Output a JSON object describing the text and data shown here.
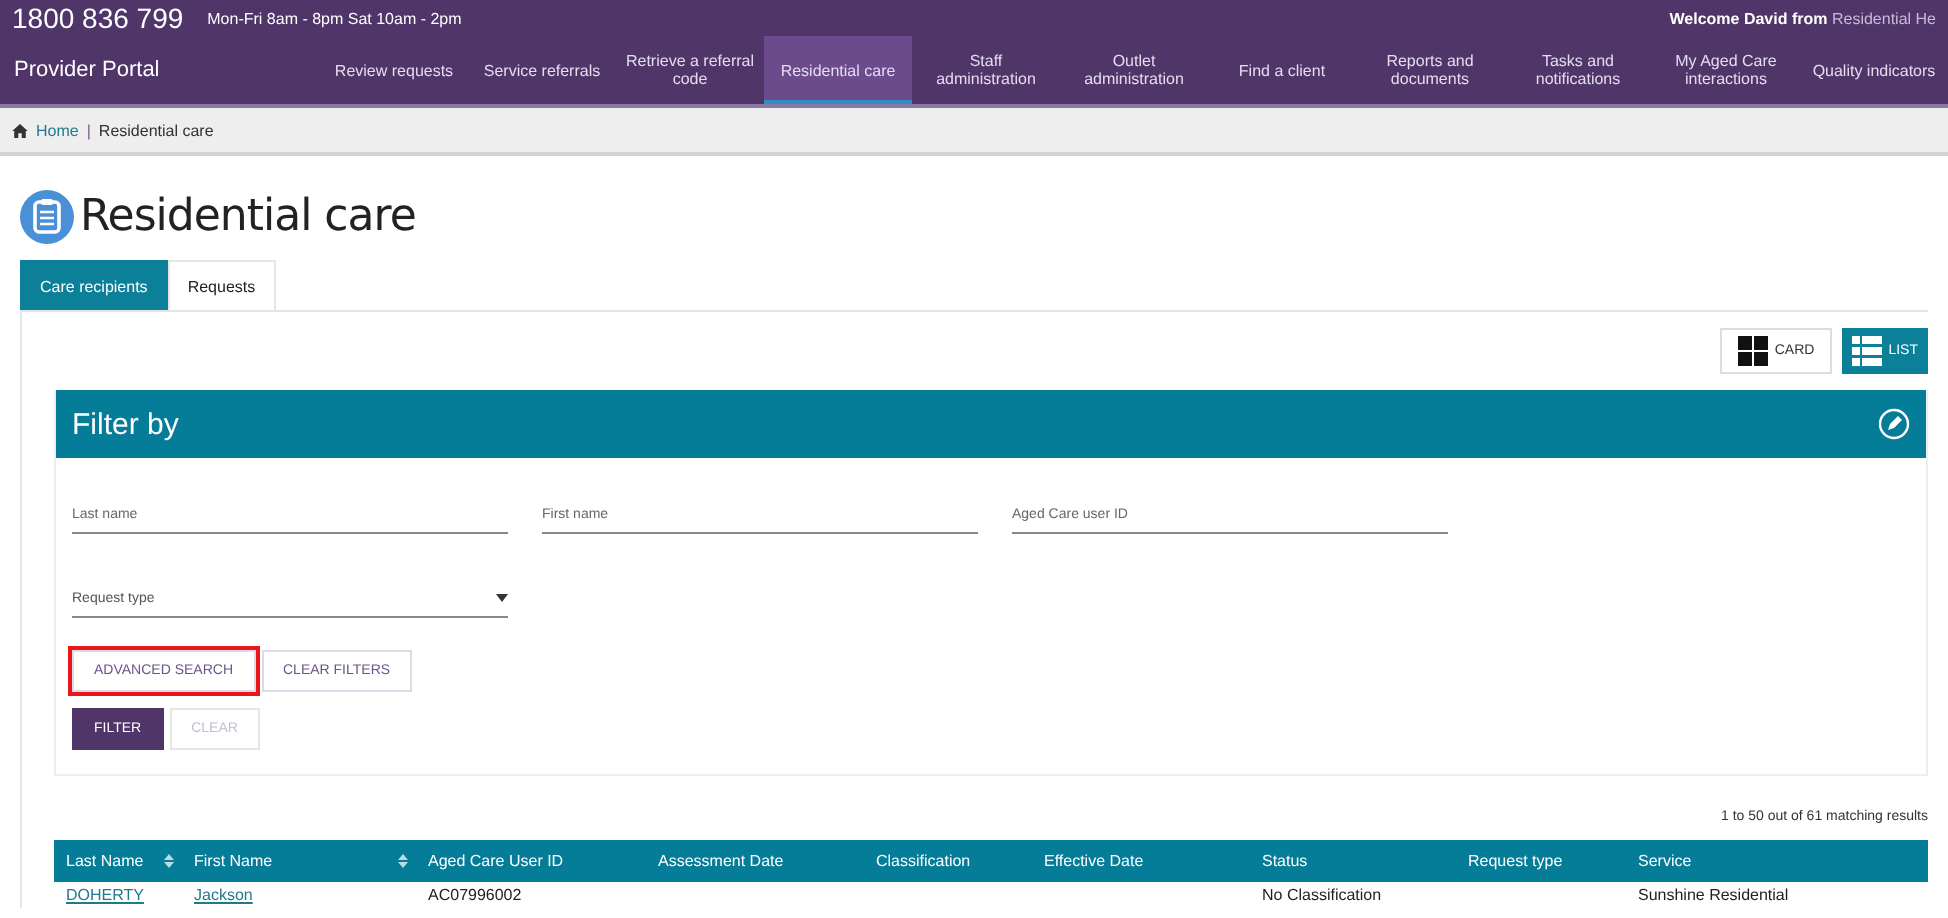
{
  "top_bar": {
    "phone": "1800 836 799",
    "hours": "Mon-Fri 8am - 8pm Sat 10am - 2pm",
    "welcome": "Welcome David from",
    "organisation": "Residential He"
  },
  "nav": {
    "brand": "Provider Portal",
    "items": [
      {
        "label": "Review requests",
        "selected": false
      },
      {
        "label": "Service referrals",
        "selected": false
      },
      {
        "label": "Retrieve a referral code",
        "selected": false
      },
      {
        "label": "Residential care",
        "selected": true
      },
      {
        "label": "Staff administration",
        "selected": false
      },
      {
        "label": "Outlet administration",
        "selected": false
      },
      {
        "label": "Find a client",
        "selected": false
      },
      {
        "label": "Reports and documents",
        "selected": false
      },
      {
        "label": "Tasks and notifications",
        "selected": false
      },
      {
        "label": "My Aged Care interactions",
        "selected": false
      },
      {
        "label": "Quality indicators",
        "selected": false
      }
    ]
  },
  "breadcrumb_separator": "|",
  "breadcrumb": [
    {
      "label": "Home",
      "kind": "link"
    },
    {
      "label": "Residential care",
      "kind": "current"
    }
  ],
  "page_title": "Residential care",
  "tabs": [
    {
      "label": "Care recipients",
      "selected": true
    },
    {
      "label": "Requests",
      "selected": false
    }
  ],
  "view_toggle": [
    {
      "label": "CARD",
      "kind": "card",
      "selected": false
    },
    {
      "label": "LIST",
      "kind": "list",
      "selected": true
    }
  ],
  "filter": {
    "title": "Filter by",
    "fields": [
      {
        "placeholder": "Last name",
        "kind": "text"
      },
      {
        "placeholder": "First name",
        "kind": "text"
      },
      {
        "placeholder": "Aged Care user ID",
        "kind": "text"
      },
      {
        "placeholder": "Request type",
        "kind": "select"
      }
    ],
    "links": [
      {
        "label": "ADVANCED SEARCH",
        "highlighted": true
      },
      {
        "label": "CLEAR FILTERS",
        "highlighted": false
      }
    ],
    "actions": [
      {
        "label": "FILTER",
        "disabled": false
      },
      {
        "label": "CLEAR",
        "disabled": true
      }
    ]
  },
  "results_summary": "1 to 50 out of 61 matching results",
  "table": {
    "columns": [
      {
        "label": "Last Name",
        "sortable": true
      },
      {
        "label": "First Name",
        "sortable": true
      },
      {
        "label": "Aged Care User ID",
        "sortable": false
      },
      {
        "label": "Assessment Date",
        "sortable": false
      },
      {
        "label": "Classification",
        "sortable": false
      },
      {
        "label": "Effective Date",
        "sortable": false
      },
      {
        "label": "Status",
        "sortable": false
      },
      {
        "label": "Request type",
        "sortable": false
      },
      {
        "label": "Service",
        "sortable": false
      }
    ],
    "rows": [
      [
        "DOHERTY",
        "Jackson",
        "AC07996002",
        "",
        "",
        "",
        "No Classification",
        "",
        "Sunshine Residential"
      ]
    ]
  }
}
